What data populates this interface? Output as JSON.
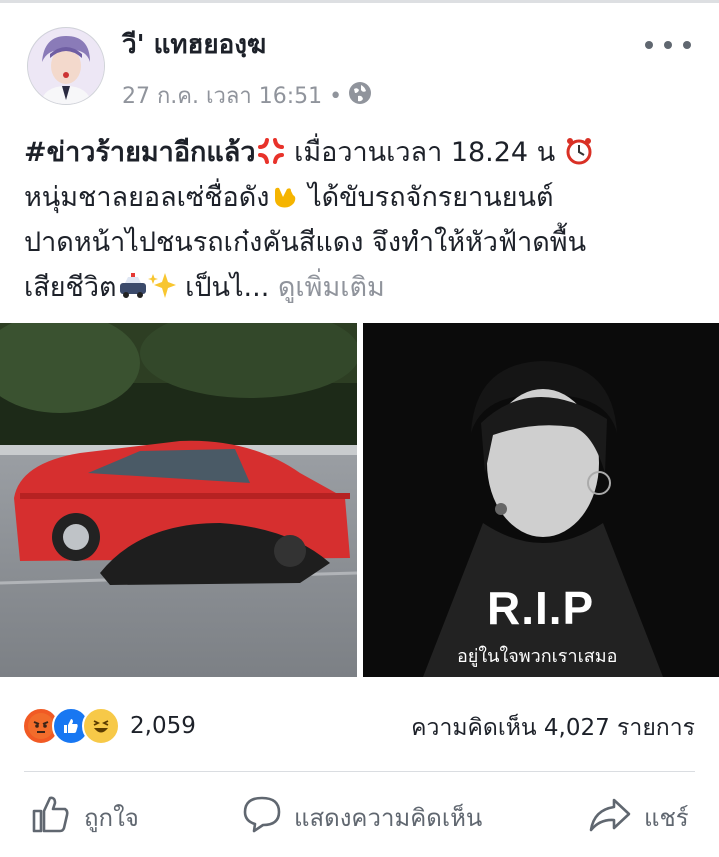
{
  "post": {
    "author": "วี' แทฮยองฺฆ",
    "timestamp": "27 ก.ค. เวลา 16:51 •",
    "privacy_icon": "globe-icon",
    "hashtag": "#ข่าวร้ายมาอีกแล้ว",
    "line1_rest": " เมื่อวานเวลา 18.24 น",
    "line2": "หนุ่มชาลยอลเซ่ชื่อดัง",
    "line2_rest": " ได้ขับรถจักรยานยนต์",
    "line3": "ปาดหน้าไปชนรถเก๋งคันสีแดง จึงทำให้หัวฟ้าดพื้น",
    "line4": "เสียชีวิต",
    "line4_rest": " เป็นไ...",
    "see_more": "ดูเพิ่มเติม"
  },
  "photos": {
    "rip_title": "R.I.P",
    "rip_caption": "อยู่ในใจพวกเราเสมอ"
  },
  "stats": {
    "reaction_icons": [
      "angry-icon",
      "like-icon",
      "haha-icon"
    ],
    "reaction_count": "2,059",
    "comments_label": "ความคิดเห็น 4,027 รายการ"
  },
  "actions": {
    "like": "ถูกใจ",
    "comment": "แสดงความคิดเห็น",
    "share": "แชร์"
  },
  "colors": {
    "text": "#1d2129",
    "secondary": "#90949c",
    "like_blue": "#1877f2",
    "angry": "#f15a24",
    "haha": "#f7c948"
  }
}
